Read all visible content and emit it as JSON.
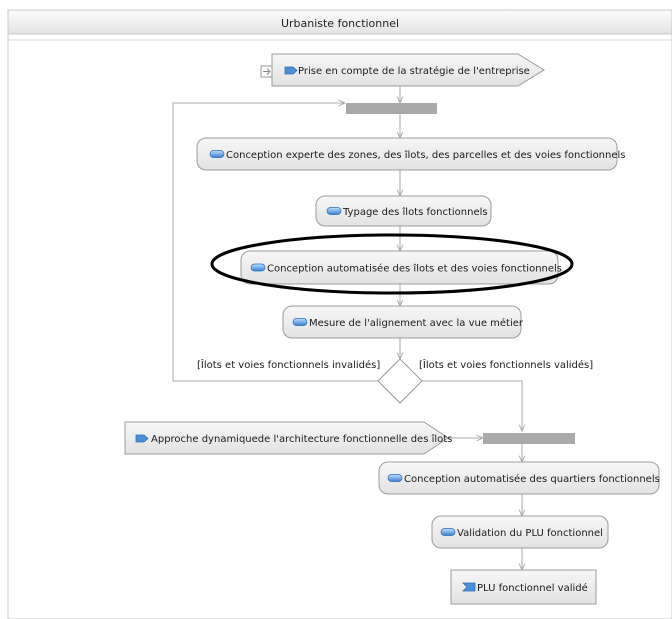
{
  "panel": {
    "title": "Urbaniste fonctionnel"
  },
  "nodes": {
    "start_signal": "Prise en compte de la stratégie de l'entreprise",
    "action_conception_zones": "Conception experte des zones, des îlots, des parcelles et des voies fonctionnels",
    "action_typage": "Typage des îlots fonctionnels",
    "action_conception_auto": "Conception automatisée des îlots et des voies fonctionnels",
    "action_mesure": "Mesure de l'alignement avec la vue métier",
    "signal_approche": "Approche dynamiquede l'architecture fonctionnelle des îlots",
    "action_quartiers": "Conception automatisée des quartiers fonctionnels",
    "action_validation": "Validation du PLU fonctionnel",
    "end_signal": "PLU fonctionnel validé"
  },
  "guards": {
    "invalid": "[Îlots et voies fonctionnels invalidés]",
    "valid": "[Îlots et voies fonctionnels validés]"
  },
  "colors": {
    "node_fill": "#ececec",
    "node_stroke": "#9c9c9c",
    "edge": "#a8a8a8",
    "bar": "#a9a9a9",
    "icon": "#4a8fd8",
    "highlight": "#000000"
  }
}
